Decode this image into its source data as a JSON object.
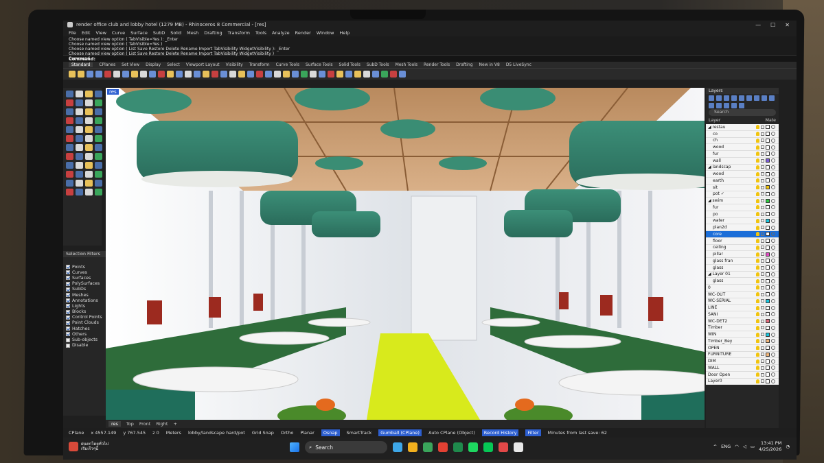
{
  "window": {
    "title": "render office club and lobby hotel (1279 MB) - Rhinoceros 8 Commercial - [res]",
    "minimize": "—",
    "maximize": "☐",
    "close": "✕"
  },
  "menu": [
    "File",
    "Edit",
    "View",
    "Curve",
    "Surface",
    "SubD",
    "Solid",
    "Mesh",
    "Drafting",
    "Transform",
    "Tools",
    "Analyze",
    "Render",
    "Window",
    "Help"
  ],
  "command_history": [
    "Choose named view option ( TabVisible=Yes ): _Enter",
    "Choose named view option ( TabVisible=Yes )",
    "Choose named view option ( List Save Restore Delete Rename Import TabVisibility WidgetVisibility ): _Enter",
    "Choose named view option ( List Save Restore Delete Rename Import TabVisibility WidgetVisibility )",
    "Command"
  ],
  "command_prompt": "Command:",
  "toolbar_tabs": [
    "Standard",
    "CPlanes",
    "Set View",
    "Display",
    "Select",
    "Viewport Layout",
    "Visibility",
    "Transform",
    "Curve Tools",
    "Surface Tools",
    "Solid Tools",
    "SubD Tools",
    "Mesh Tools",
    "Render Tools",
    "Drafting",
    "New in V8",
    "D5 LiveSync"
  ],
  "toolbar_icon_colors": [
    "#e8c15a",
    "#e8c15a",
    "#6a8fd6",
    "#6a8fd6",
    "#c74040",
    "#d9d9d9",
    "#6a8fd6",
    "#e8c15a",
    "#d9d9d9",
    "#6a8fd6",
    "#c74040",
    "#e8c15a",
    "#6a8fd6",
    "#d9d9d9",
    "#6a8fd6",
    "#e8c15a",
    "#c74040",
    "#6a8fd6",
    "#d9d9d9",
    "#e8c15a",
    "#6a8fd6",
    "#c74040",
    "#6a8fd6",
    "#d9d9d9",
    "#e8c15a",
    "#6a8fd6",
    "#3aa55b",
    "#d9d9d9",
    "#6a8fd6",
    "#c74040",
    "#e8c15a",
    "#6a8fd6",
    "#e8c15a",
    "#d9d9d9",
    "#6a8fd6",
    "#3aa55b",
    "#c74040",
    "#6a8fd6"
  ],
  "viewport": {
    "name": "res",
    "tabs": [
      "res",
      "Top",
      "Front",
      "Right"
    ],
    "add_tab": "+"
  },
  "selection_filters": {
    "title": "Selection Filters",
    "items": [
      {
        "label": "Points",
        "checked": true
      },
      {
        "label": "Curves",
        "checked": true
      },
      {
        "label": "Surfaces",
        "checked": true
      },
      {
        "label": "PolySurfaces",
        "checked": true
      },
      {
        "label": "SubDs",
        "checked": true
      },
      {
        "label": "Meshes",
        "checked": true
      },
      {
        "label": "Annotations",
        "checked": true
      },
      {
        "label": "Lights",
        "checked": true
      },
      {
        "label": "Blocks",
        "checked": true
      },
      {
        "label": "Control Points",
        "checked": true
      },
      {
        "label": "Point Clouds",
        "checked": true
      },
      {
        "label": "Hatches",
        "checked": true
      },
      {
        "label": "Others",
        "checked": true
      },
      {
        "label": "Sub-objects",
        "checked": false
      },
      {
        "label": "Disable",
        "checked": false
      }
    ]
  },
  "layers": {
    "title": "Layers",
    "search_placeholder": "Search",
    "col_layer": "Layer",
    "col_material": "Mate",
    "rows": [
      {
        "name": "◢ restau",
        "color": "#ffffff",
        "selected": false
      },
      {
        "name": "co",
        "color": "#ffffff",
        "selected": false
      },
      {
        "name": "ch",
        "color": "#ffffff",
        "selected": false
      },
      {
        "name": "wood",
        "color": "#ffffff",
        "selected": false
      },
      {
        "name": "fur",
        "color": "#ffffff",
        "selected": false
      },
      {
        "name": "wall",
        "color": "#7a5cd6",
        "selected": false
      },
      {
        "name": "◢ landscap",
        "color": "#ffffff",
        "selected": false
      },
      {
        "name": "wood",
        "color": "#ffffff",
        "selected": false
      },
      {
        "name": "earth",
        "color": "#ffffff",
        "selected": false
      },
      {
        "name": "sit",
        "color": "#f1c40f",
        "selected": false
      },
      {
        "name": "pot ✓",
        "color": "#ffffff",
        "selected": false
      },
      {
        "name": "◢ swim",
        "color": "#2ecc40",
        "selected": false
      },
      {
        "name": "fur",
        "color": "#ffffff",
        "selected": false
      },
      {
        "name": "po",
        "color": "#ffffff",
        "selected": false
      },
      {
        "name": "water",
        "color": "#18c7e0",
        "selected": false
      },
      {
        "name": "plan2d",
        "color": "#ffffff",
        "selected": false
      },
      {
        "name": "core",
        "color": "#ffffff",
        "selected": true
      },
      {
        "name": "floor",
        "color": "#ffffff",
        "selected": false
      },
      {
        "name": "ceiling",
        "color": "#ffffff",
        "selected": false
      },
      {
        "name": "pillar",
        "color": "#e04bc1",
        "selected": false
      },
      {
        "name": "glass fran",
        "color": "#ffffff",
        "selected": false
      },
      {
        "name": "glass",
        "color": "#ffffff",
        "selected": false
      },
      {
        "name": "◢ Layer 01",
        "color": "#ffffff",
        "selected": false
      },
      {
        "name": "glass",
        "color": "#ffffff",
        "selected": false
      },
      {
        "name": "0",
        "color": "#ffffff",
        "selected": false
      },
      {
        "name": "WC-OUT",
        "color": "#ffffff",
        "selected": false
      },
      {
        "name": "WC-SERIAL",
        "color": "#18c7e0",
        "selected": false
      },
      {
        "name": "LINE",
        "color": "#ffffff",
        "selected": false
      },
      {
        "name": "SANI",
        "color": "#ffffff",
        "selected": false
      },
      {
        "name": "WC-DET2",
        "color": "#e06a7a",
        "selected": false
      },
      {
        "name": "Timber",
        "color": "#ffffff",
        "selected": false
      },
      {
        "name": "WIN",
        "color": "#18c7e0",
        "selected": false
      },
      {
        "name": "Timber_Bey",
        "color": "#f0b57a",
        "selected": false
      },
      {
        "name": "OPEN",
        "color": "#ffffff",
        "selected": false
      },
      {
        "name": "FURNITURE",
        "color": "#f0b57a",
        "selected": false
      },
      {
        "name": "DIM",
        "color": "#ffffff",
        "selected": false
      },
      {
        "name": "WALL",
        "color": "#ffffff",
        "selected": false
      },
      {
        "name": "Door Open",
        "color": "#ffffff",
        "selected": false
      },
      {
        "name": "Layer0",
        "color": "#ffffff",
        "selected": false
      }
    ]
  },
  "status_bar": {
    "cplane": "CPlane",
    "x": "x 4557.149",
    "y": "y 767.545",
    "z": "z 0",
    "units": "Meters",
    "layer": "lobby/landscape hard/pot",
    "grid_snap": "Grid Snap",
    "ortho": "Ortho",
    "planar": "Planar",
    "osnap": "Osnap",
    "smarttrack": "SmartTrack",
    "gumball": "Gumball (CPlane)",
    "auto_cplane": "Auto CPlane (Object)",
    "record_history": "Record History",
    "filter": "Filter",
    "last_save": "Minutes from last save: 62"
  },
  "taskbar": {
    "weather_line1": "ฝนตกโดยทั่วไป",
    "weather_line2": "เริ่มเร็วๆนี้",
    "search": "Search",
    "lang": "ENG",
    "time": "13:41 PM",
    "date": "4/25/2026",
    "app_colors": [
      "#3ea7e8",
      "#f2b01e",
      "#3aa55b",
      "#e34133",
      "#1f8a4c",
      "#1ed760",
      "#06c755",
      "#e24848",
      "#e8e8e8"
    ]
  }
}
